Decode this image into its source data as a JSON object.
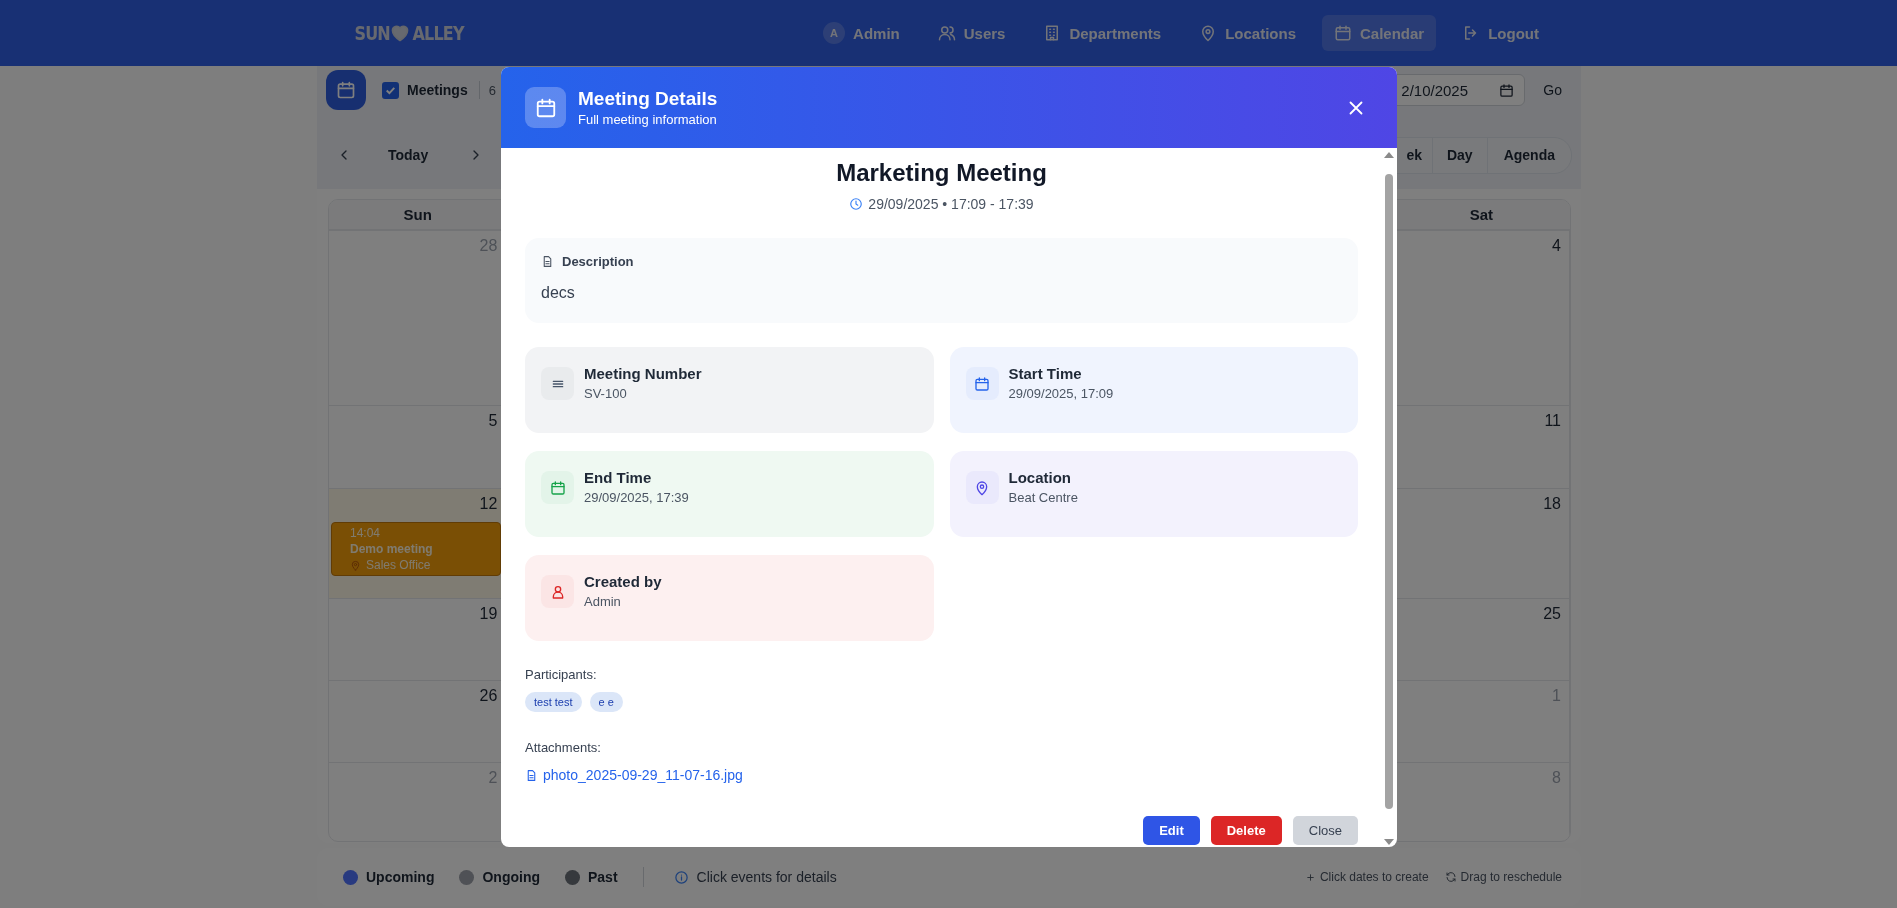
{
  "header": {
    "logo": {
      "left": "SUN",
      "right": "ALLEY"
    },
    "nav": [
      {
        "label": "Admin",
        "badge": "A",
        "selected": false
      },
      {
        "label": "Users",
        "selected": false
      },
      {
        "label": "Departments",
        "selected": false
      },
      {
        "label": "Locations",
        "selected": false
      },
      {
        "label": "Calendar",
        "selected": true
      },
      {
        "label": "Logout",
        "selected": false
      }
    ]
  },
  "toolbar": {
    "filter": {
      "label": "Meetings",
      "checked": true
    },
    "count": "6",
    "date_field": {
      "value": "2/10/2025"
    },
    "go_button": "Go",
    "today_button": "Today",
    "views": [
      {
        "label": "ek",
        "selected": false
      },
      {
        "label": "Day",
        "selected": false
      },
      {
        "label": "Agenda",
        "selected": false
      }
    ]
  },
  "calendar": {
    "columns": [
      "Sun",
      "Sat"
    ],
    "weeks": [
      {
        "sun": {
          "day": "28",
          "other_month": true,
          "highlighted": false
        },
        "sat": {
          "day": "4",
          "other_month": false,
          "highlighted": false
        }
      },
      {
        "sun": {
          "day": "5",
          "other_month": false,
          "highlighted": false
        },
        "sat": {
          "day": "11",
          "other_month": false,
          "highlighted": false
        }
      },
      {
        "sun": {
          "day": "12",
          "other_month": false,
          "highlighted": true,
          "events": [
            {
              "time": "14:04",
              "title": "Demo meeting",
              "location": "Sales Office"
            }
          ]
        },
        "sat": {
          "day": "18",
          "other_month": false,
          "highlighted": false
        }
      },
      {
        "sun": {
          "day": "19",
          "other_month": false,
          "highlighted": false
        },
        "sat": {
          "day": "25",
          "other_month": false,
          "highlighted": false
        }
      },
      {
        "sun": {
          "day": "26",
          "other_month": false,
          "highlighted": false
        },
        "sat": {
          "day": "1",
          "other_month": true,
          "highlighted": false
        }
      },
      {
        "sun": {
          "day": "2",
          "other_month": true,
          "highlighted": false
        },
        "sat": {
          "day": "8",
          "other_month": true,
          "highlighted": false
        }
      }
    ]
  },
  "legend": {
    "items": [
      {
        "label": "Upcoming",
        "color": "#283a80"
      },
      {
        "label": "Ongoing",
        "color": "#4f5156"
      },
      {
        "label": "Past",
        "color": "#36393d"
      }
    ],
    "info": "Click events for details",
    "create_hint": "Click dates to create",
    "reschedule_hint": "Drag to reschedule"
  },
  "modal": {
    "title": "Meeting Details",
    "subtitle": "Full meeting information",
    "meeting_title": "Marketing Meeting",
    "datetime": "29/09/2025 • 17:09 - 17:39",
    "description": {
      "label": "Description",
      "text": "decs"
    },
    "details": [
      {
        "label": "Meeting Number",
        "value": "SV-100",
        "color": "#475569"
      },
      {
        "label": "Start Time",
        "value": "29/09/2025, 17:09",
        "color": "#2563eb"
      },
      {
        "label": "End Time",
        "value": "29/09/2025, 17:39",
        "color": "#16a34a"
      },
      {
        "label": "Location",
        "value": "Beat Centre",
        "color": "#4f46e5"
      },
      {
        "label": "Created by",
        "value": "Admin",
        "color": "#dc2626"
      }
    ],
    "participants": {
      "label": "Participants:",
      "items": [
        "test test",
        "e e"
      ]
    },
    "attachments": {
      "label": "Attachments:",
      "files": [
        "photo_2025-09-29_11-07-16.jpg"
      ]
    },
    "buttons": [
      {
        "label": "Edit",
        "kind": "primary"
      },
      {
        "label": "Delete",
        "kind": "danger"
      },
      {
        "label": "Close",
        "kind": "secondary"
      }
    ]
  }
}
